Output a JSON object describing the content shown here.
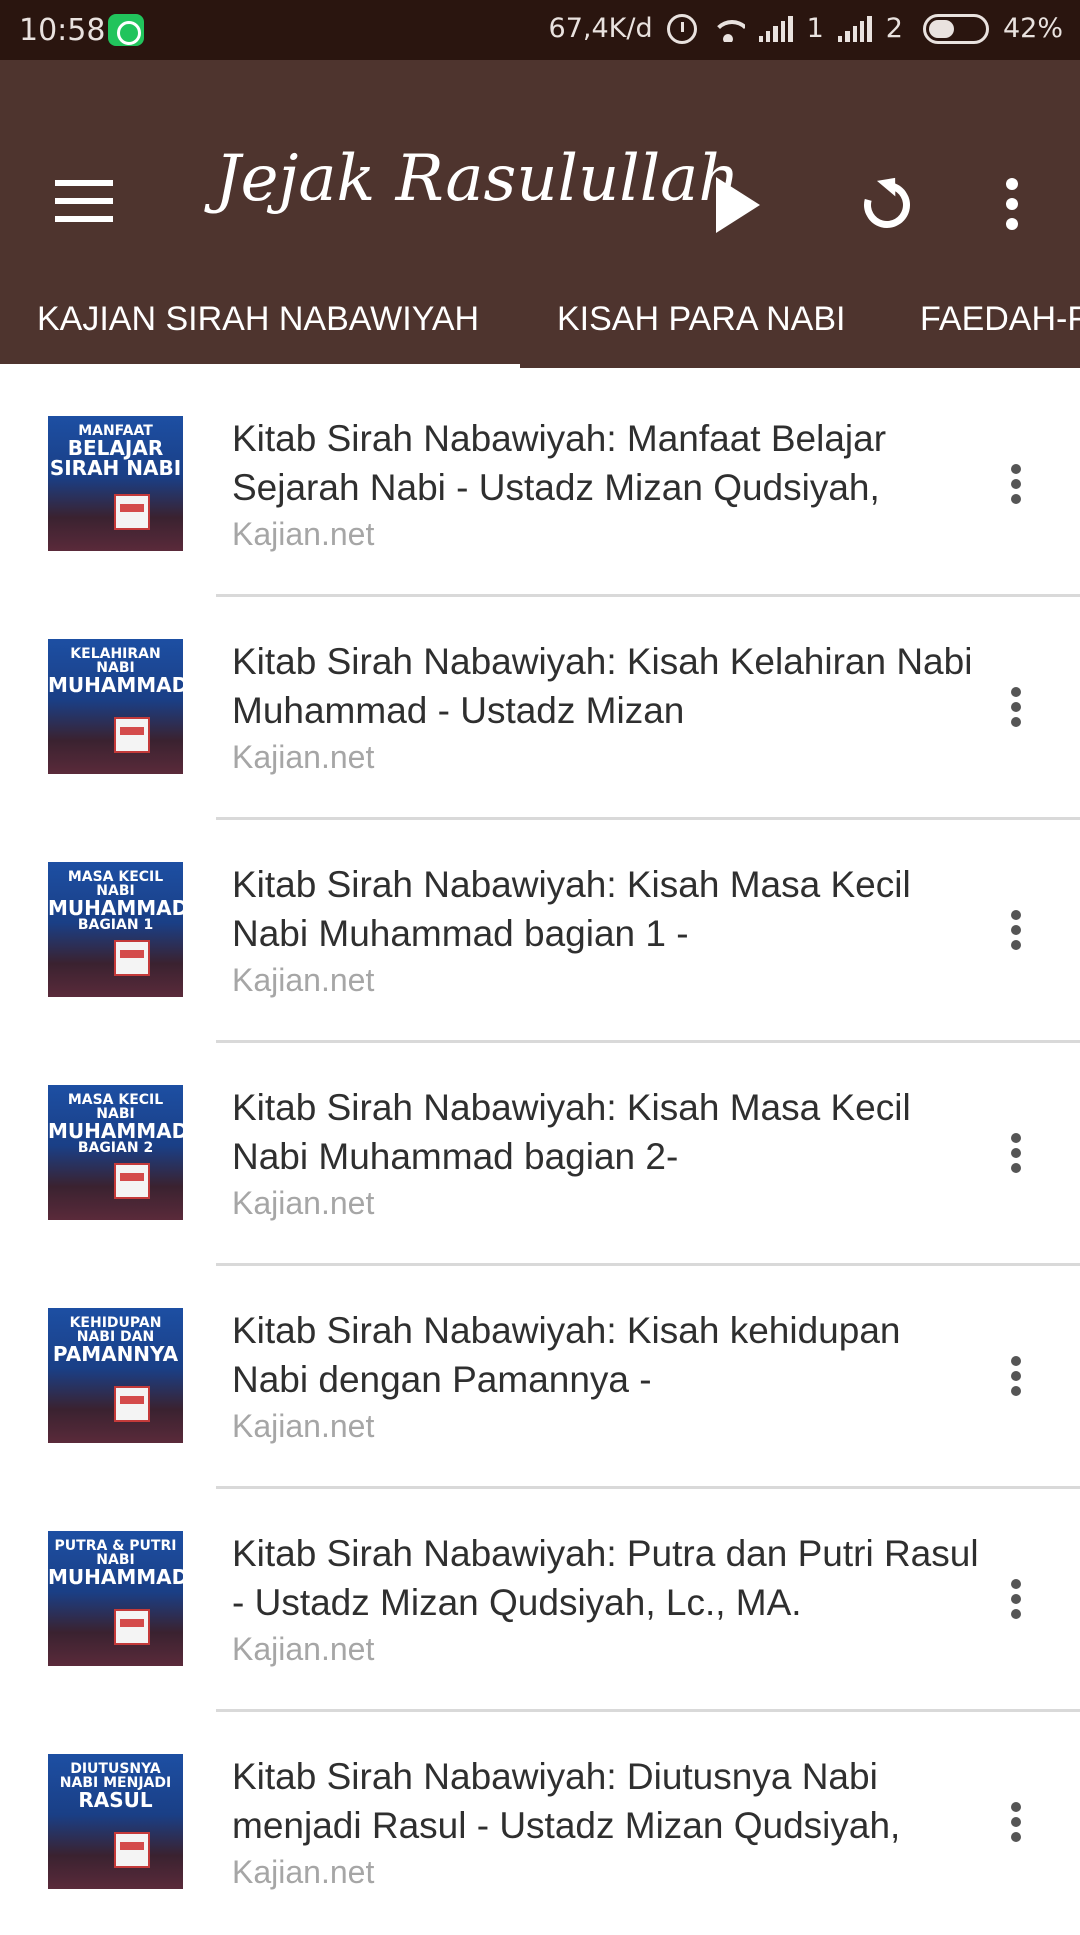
{
  "status_bar": {
    "time": "10:58",
    "net_speed": "67,4K/d",
    "sim1": "1",
    "sim2": "2",
    "battery": "42%"
  },
  "app_bar": {
    "title": "Jejak Rasulullah"
  },
  "tabs": [
    {
      "label": "KAJIAN SIRAH NABAWIYAH",
      "selected": true
    },
    {
      "label": "KISAH PARA NABI",
      "selected": false
    },
    {
      "label": "FAEDAH-F",
      "selected": false
    }
  ],
  "items": [
    {
      "thumb_lines": [
        "MANFAAT",
        "BELAJAR",
        "SIRAH NABI"
      ],
      "title": "Kitab Sirah Nabawiyah: Manfaat Belajar Sejarah Nabi - Ustadz Mizan Qudsiyah,",
      "source": "Kajian.net"
    },
    {
      "thumb_lines": [
        "KELAHIRAN",
        "NABI",
        "MUHAMMAD"
      ],
      "title": "Kitab Sirah Nabawiyah: Kisah Kelahiran Nabi Muhammad - Ustadz Mizan",
      "source": "Kajian.net"
    },
    {
      "thumb_lines": [
        "MASA KECIL",
        "NABI",
        "MUHAMMAD",
        "BAGIAN 1"
      ],
      "title": "Kitab Sirah Nabawiyah: Kisah Masa Kecil Nabi Muhammad bagian 1 -",
      "source": "Kajian.net"
    },
    {
      "thumb_lines": [
        "MASA KECIL",
        "NABI",
        "MUHAMMAD",
        "BAGIAN 2"
      ],
      "title": "Kitab Sirah Nabawiyah: Kisah Masa Kecil Nabi Muhammad bagian 2-",
      "source": "Kajian.net"
    },
    {
      "thumb_lines": [
        "KEHIDUPAN",
        "NABI DAN",
        "PAMANNYA"
      ],
      "title": "Kitab Sirah Nabawiyah: Kisah kehidupan Nabi dengan Pamannya -",
      "source": "Kajian.net"
    },
    {
      "thumb_lines": [
        "PUTRA & PUTRI",
        "NABI",
        "MUHAMMAD"
      ],
      "title": "Kitab Sirah Nabawiyah: Putra dan Putri Rasul - Ustadz Mizan Qudsiyah, Lc., MA.",
      "source": "Kajian.net"
    },
    {
      "thumb_lines": [
        "DIUTUSNYA",
        "NABI MENJADI",
        "RASUL"
      ],
      "title": "Kitab Sirah Nabawiyah: Diutusnya Nabi menjadi Rasul - Ustadz Mizan Qudsiyah,",
      "source": "Kajian.net"
    }
  ],
  "colors": {
    "status_bar": "#2a150f",
    "app_bar": "#4e342e",
    "accent": "#ffffff"
  }
}
